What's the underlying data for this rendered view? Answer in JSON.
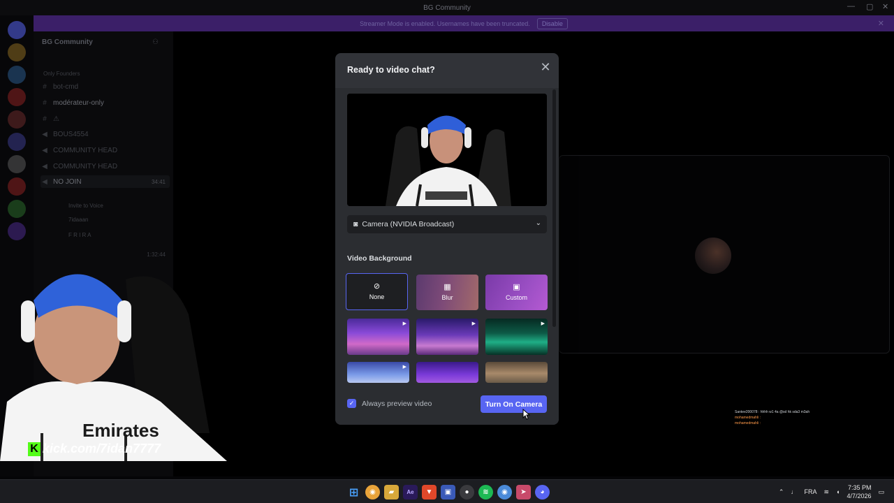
{
  "window": {
    "title": "BG Community"
  },
  "banner": {
    "message": "Streamer Mode is enabled. Usernames have been truncated.",
    "disable_label": "Disable"
  },
  "sidebar": {
    "guild_name": "BG Community",
    "category": "Only Founders",
    "channels": [
      {
        "icon": "text-channel-icon",
        "label": "bot-cmd"
      },
      {
        "icon": "text-channel-icon",
        "label": "modérateur-only"
      },
      {
        "icon": "text-channel-icon",
        "label": "⚠"
      },
      {
        "icon": "voice-channel-icon",
        "label": "BOUS4554"
      },
      {
        "icon": "voice-channel-icon",
        "label": "COMMUNITY HEAD"
      },
      {
        "icon": "voice-channel-icon",
        "label": "COMMUNITY HEAD"
      },
      {
        "icon": "voice-channel-icon",
        "label": "NO JOIN"
      }
    ],
    "voice_timer": "34:41",
    "voice_members": [
      "Invite to Voice",
      "7idaaan",
      "F R I R A"
    ],
    "second_timer": "1:32:44"
  },
  "modal": {
    "title": "Ready to video chat?",
    "camera_device": "Camera (NVIDIA Broadcast)",
    "section_title": "Video Background",
    "bg_options": [
      {
        "label": "None",
        "icon": "none-icon",
        "selected": true
      },
      {
        "label": "Blur",
        "icon": "blur-icon",
        "selected": false
      },
      {
        "label": "Custom",
        "icon": "custom-image-icon",
        "selected": false
      }
    ],
    "always_preview_label": "Always preview video",
    "always_preview_checked": true,
    "turn_on_label": "Turn On Camera"
  },
  "overlay": {
    "kick_url": "kick.com/7idan7777",
    "chat_lines": [
      "Santee200078 : hhhh w1 4a @sd hk sda3 m3ah",
      "mohamedmahli : ",
      "mohamedmahli : "
    ]
  },
  "taskbar": {
    "language": "FRA",
    "time": "7:35 PM",
    "date": "4/7/2026"
  },
  "colors": {
    "accent": "#5865f2",
    "modal_bg": "#313338",
    "banner_bg": "#3b1f68"
  }
}
